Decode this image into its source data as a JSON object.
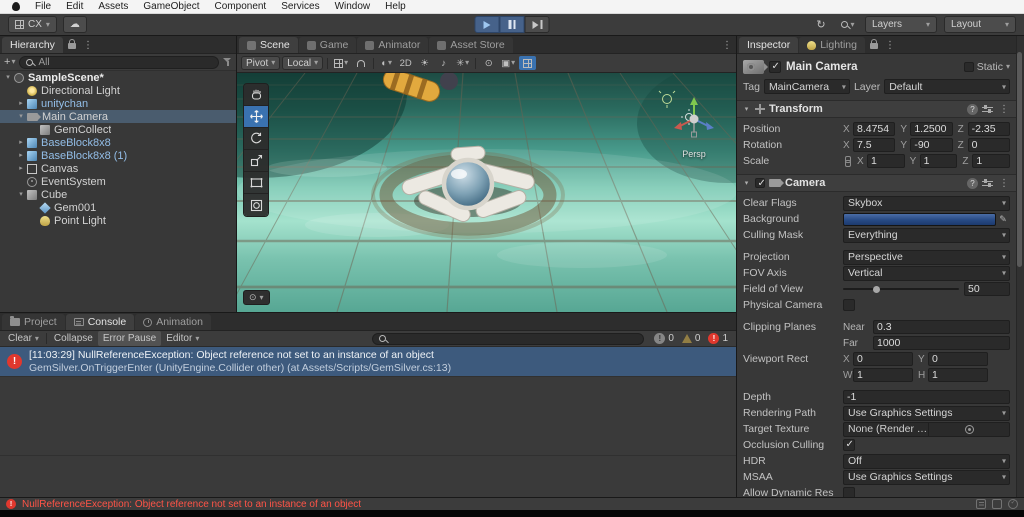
{
  "menubar": {
    "items": [
      "File",
      "Edit",
      "Assets",
      "GameObject",
      "Component",
      "Services",
      "Window",
      "Help"
    ]
  },
  "toolbar": {
    "account_label": "CX",
    "layers_label": "Layers",
    "layout_label": "Layout"
  },
  "hierarchy": {
    "title": "Hierarchy",
    "search_filter": "All",
    "items": [
      {
        "label": "SampleScene*"
      },
      {
        "label": "Directional Light"
      },
      {
        "label": "unitychan"
      },
      {
        "label": "Main Camera"
      },
      {
        "label": "GemCollect"
      },
      {
        "label": "BaseBlock8x8"
      },
      {
        "label": "BaseBlock8x8 (1)"
      },
      {
        "label": "Canvas"
      },
      {
        "label": "EventSystem"
      },
      {
        "label": "Cube"
      },
      {
        "label": "Gem001"
      },
      {
        "label": "Point Light"
      }
    ]
  },
  "scene": {
    "tabs": [
      "Scene",
      "Game",
      "Animator",
      "Asset Store"
    ],
    "pivot_label": "Pivot",
    "local_label": "Local",
    "mode_2d_label": "2D",
    "persp_label": "Persp"
  },
  "console": {
    "tabs": [
      "Project",
      "Console",
      "Animation"
    ],
    "clear_label": "Clear",
    "collapse_label": "Collapse",
    "error_pause_label": "Error Pause",
    "editor_label": "Editor",
    "info_count": "0",
    "warning_count": "0",
    "error_count": "1",
    "entry_line1": "[11:03:29] NullReferenceException: Object reference not set to an instance of an object",
    "entry_line2": "GemSilver.OnTriggerEnter (UnityEngine.Collider other) (at Assets/Scripts/GemSilver.cs:13)"
  },
  "inspector": {
    "tabs": [
      "Inspector",
      "Lighting"
    ],
    "object_name": "Main Camera",
    "static_label": "Static",
    "tag_label": "Tag",
    "tag_value": "MainCamera",
    "layer_label": "Layer",
    "layer_value": "Default",
    "transform": {
      "title": "Transform",
      "position_label": "Position",
      "rotation_label": "Rotation",
      "scale_label": "Scale",
      "x_label": "X",
      "y_label": "Y",
      "z_label": "Z",
      "position": {
        "x": "8.4754",
        "y": "1.2500",
        "z": "-2.35"
      },
      "rotation": {
        "x": "7.5",
        "y": "-90",
        "z": "0"
      },
      "scale": {
        "x": "1",
        "y": "1",
        "z": "1"
      }
    },
    "camera": {
      "title": "Camera",
      "clear_flags_label": "Clear Flags",
      "clear_flags_value": "Skybox",
      "background_label": "Background",
      "background_style": "background:linear-gradient(180deg,#4a6da6 0%,#274a85 55%,#1c3a6e 100%)",
      "culling_mask_label": "Culling Mask",
      "culling_mask_value": "Everything",
      "projection_label": "Projection",
      "projection_value": "Perspective",
      "fov_axis_label": "FOV Axis",
      "fov_axis_value": "Vertical",
      "fov_label": "Field of View",
      "fov_value": "50",
      "physical_label": "Physical Camera",
      "clipping_label": "Clipping Planes",
      "near_label": "Near",
      "near_value": "0.3",
      "far_label": "Far",
      "far_value": "1000",
      "viewport_label": "Viewport Rect",
      "x_label": "X",
      "y_label": "Y",
      "w_label": "W",
      "h_label": "H",
      "vx": "0",
      "vy": "0",
      "vw": "1",
      "vh": "1",
      "depth_label": "Depth",
      "depth_value": "-1",
      "rendering_path_label": "Rendering Path",
      "rendering_path_value": "Use Graphics Settings",
      "target_texture_label": "Target Texture",
      "target_texture_value": "None (Render Texture)",
      "occlusion_label": "Occlusion Culling",
      "hdr_label": "HDR",
      "hdr_value": "Off",
      "msaa_label": "MSAA",
      "msaa_value": "Use Graphics Settings",
      "allow_dynamic_label": "Allow Dynamic Res"
    }
  },
  "statusbar": {
    "message": "NullReferenceException: Object reference not set to an instance of an object"
  },
  "colors": {
    "selection_blue": "#3d5a7d",
    "hierarchy_selection": "#4a5c6e",
    "error_red": "#e0382e",
    "camera_background_swatch": "#274a85",
    "play_active_blue": "#46628a"
  }
}
